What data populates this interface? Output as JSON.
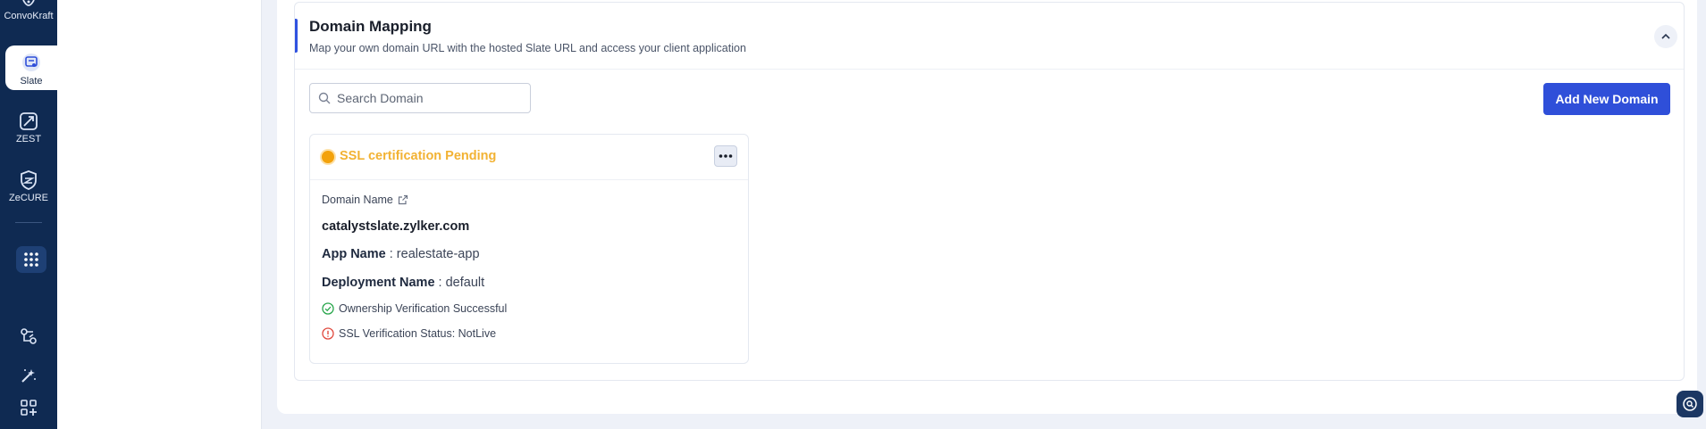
{
  "rail": {
    "items": [
      {
        "label": "ConvoKraft",
        "icon": "convokraft-icon"
      },
      {
        "label": "Slate",
        "icon": "slate-icon",
        "active": true
      },
      {
        "label": "ZEST",
        "icon": "zest-icon"
      },
      {
        "label": "ZeCURE",
        "icon": "zecure-icon"
      }
    ],
    "bottom_icons": [
      "apps-grid-icon",
      "integrations-icon",
      "tools-icon",
      "add-widget-icon"
    ]
  },
  "section": {
    "title": "Domain Mapping",
    "subtitle": "Map your own domain URL with the hosted Slate URL and access your client application"
  },
  "search": {
    "placeholder": "Search Domain",
    "value": ""
  },
  "add_button": {
    "label": "Add New Domain"
  },
  "domain_card": {
    "status": "SSL certification Pending",
    "status_color": "#f3a20c",
    "domain_name_label": "Domain Name",
    "domain_name": "catalystslate.zylker.com",
    "app_name_label": "App Name",
    "app_name": " : realestate-app",
    "deployment_label": "Deployment Name",
    "deployment_name": " : default",
    "ownership_text": "Ownership Verification Successful",
    "ssl_text": "SSL Verification Status: NotLive"
  },
  "colors": {
    "accent": "#2f4fd9",
    "rail": "#0f2a52",
    "success": "#27a54a",
    "error": "#e0493e"
  }
}
